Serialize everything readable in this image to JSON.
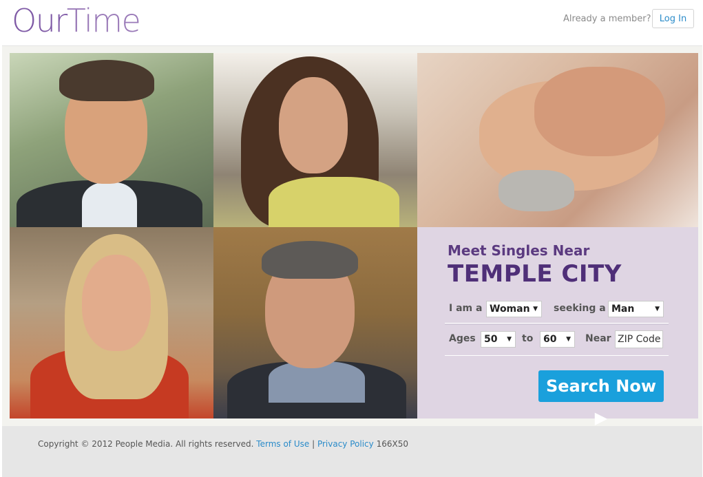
{
  "header": {
    "logo_part1": "Our",
    "logo_part2": "Time",
    "already_member": "Already a member?",
    "login_label": "Log In"
  },
  "search_panel": {
    "headline": "Meet Singles Near",
    "city": "TEMPLE CITY",
    "i_am_label": "I am a",
    "i_am_value": "Woman",
    "seeking_label": "seeking a",
    "seeking_value": "Man",
    "ages_label": "Ages",
    "age_min": "50",
    "to_label": "to",
    "age_max": "60",
    "near_label": "Near",
    "zip_placeholder": "ZIP Code",
    "search_button": "Search Now ▶"
  },
  "footer": {
    "copyright": "Copyright © 2012 People Media. All rights reserved.",
    "terms": "Terms of Use",
    "separator": "|",
    "privacy": "Privacy Policy",
    "size_note": "166X50"
  },
  "colors": {
    "brand_purple": "#7f5aa6",
    "headline_purple": "#4f2f78",
    "link_blue": "#2a8bc9",
    "button_blue": "#1aa0dc",
    "panel_bg": "#dfd5e3"
  }
}
